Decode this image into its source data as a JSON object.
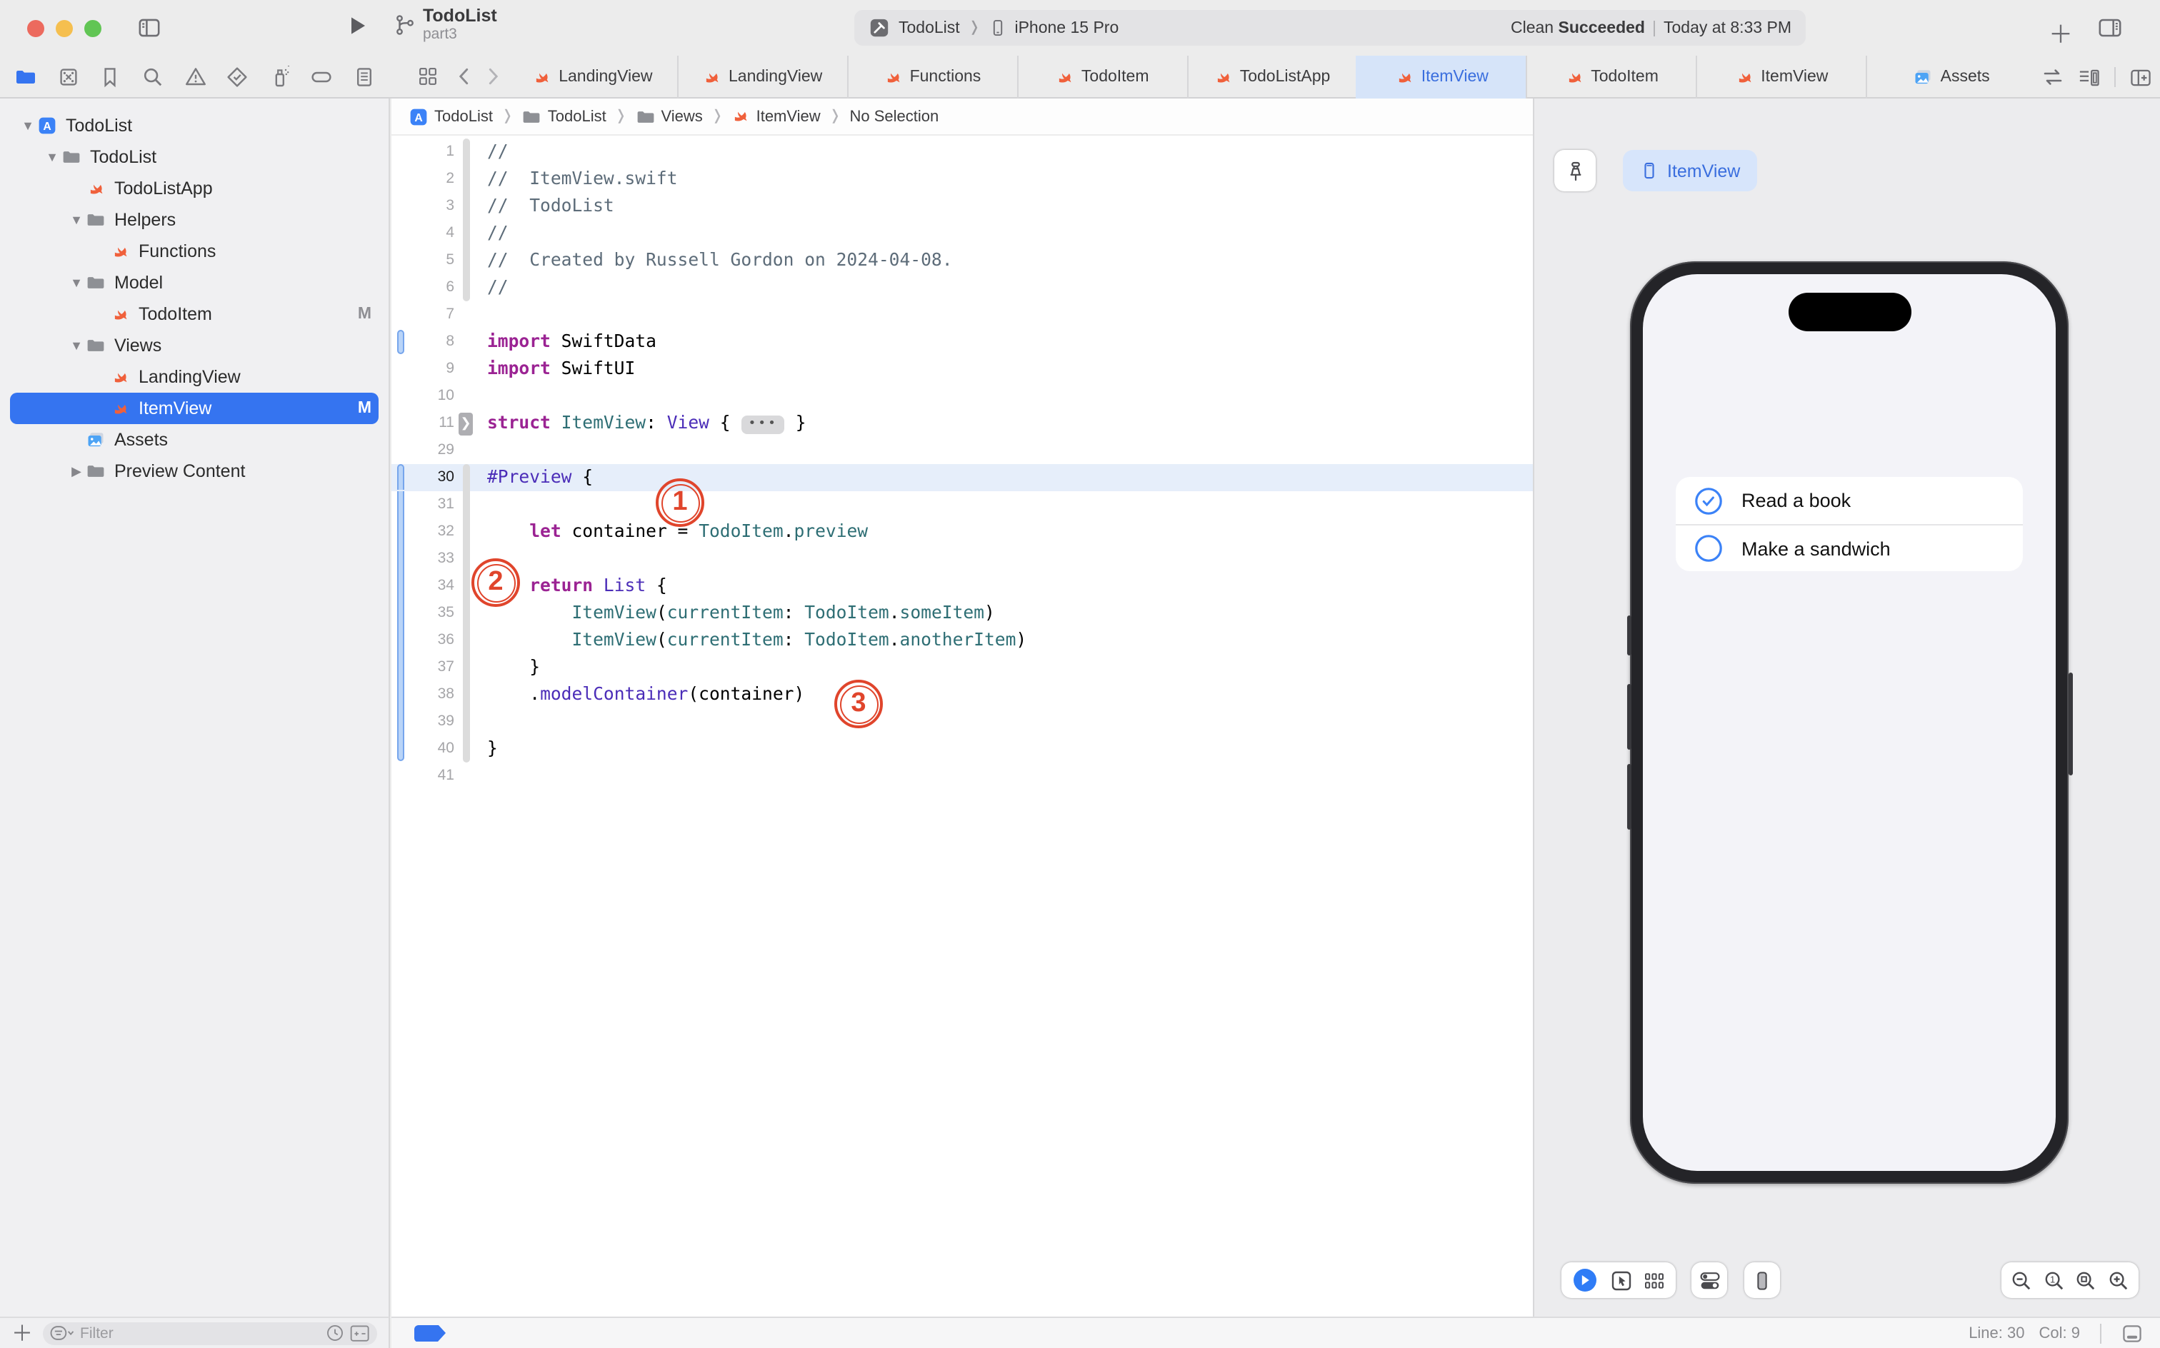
{
  "titlebar": {
    "project": "TodoList",
    "branch": "part3",
    "scheme_target": "TodoList",
    "scheme_device": "iPhone 15 Pro",
    "status_action": "Clean",
    "status_result": "Succeeded",
    "status_time": "Today at 8:33 PM"
  },
  "navigators": [
    "project",
    "source-control",
    "bookmarks",
    "find",
    "issues",
    "tests",
    "debug",
    "breakpoints",
    "reports"
  ],
  "tabs": [
    {
      "label": "LandingView",
      "icon": "swift",
      "active": false
    },
    {
      "label": "LandingView",
      "icon": "swift",
      "active": false
    },
    {
      "label": "Functions",
      "icon": "swift",
      "active": false
    },
    {
      "label": "TodoItem",
      "icon": "swift",
      "active": false
    },
    {
      "label": "TodoListApp",
      "icon": "swift",
      "active": false
    },
    {
      "label": "ItemView",
      "icon": "swift",
      "active": true
    },
    {
      "label": "TodoItem",
      "icon": "swift",
      "active": false
    },
    {
      "label": "ItemView",
      "icon": "swift",
      "active": false
    },
    {
      "label": "Assets",
      "icon": "assets",
      "active": false
    }
  ],
  "breadcrumb": [
    {
      "icon": "app",
      "label": "TodoList"
    },
    {
      "icon": "folder",
      "label": "TodoList"
    },
    {
      "icon": "folder",
      "label": "Views"
    },
    {
      "icon": "swift",
      "label": "ItemView"
    },
    {
      "icon": "none",
      "label": "No Selection"
    }
  ],
  "sidebar": {
    "items": [
      {
        "label": "TodoList",
        "icon": "app",
        "depth": 0,
        "disc": "open",
        "sel": false,
        "badge": ""
      },
      {
        "label": "TodoList",
        "icon": "folder",
        "depth": 1,
        "disc": "open",
        "sel": false,
        "badge": ""
      },
      {
        "label": "TodoListApp",
        "icon": "swift",
        "depth": 2,
        "disc": "none",
        "sel": false,
        "badge": ""
      },
      {
        "label": "Helpers",
        "icon": "folder",
        "depth": 2,
        "disc": "open",
        "sel": false,
        "badge": ""
      },
      {
        "label": "Functions",
        "icon": "swift",
        "depth": 3,
        "disc": "none",
        "sel": false,
        "badge": ""
      },
      {
        "label": "Model",
        "icon": "folder",
        "depth": 2,
        "disc": "open",
        "sel": false,
        "badge": ""
      },
      {
        "label": "TodoItem",
        "icon": "swift",
        "depth": 3,
        "disc": "none",
        "sel": false,
        "badge": "M"
      },
      {
        "label": "Views",
        "icon": "folder",
        "depth": 2,
        "disc": "open",
        "sel": false,
        "badge": ""
      },
      {
        "label": "LandingView",
        "icon": "swift",
        "depth": 3,
        "disc": "none",
        "sel": false,
        "badge": ""
      },
      {
        "label": "ItemView",
        "icon": "swift",
        "depth": 3,
        "disc": "none",
        "sel": true,
        "badge": "M"
      },
      {
        "label": "Assets",
        "icon": "assets",
        "depth": 2,
        "disc": "none",
        "sel": false,
        "badge": ""
      },
      {
        "label": "Preview Content",
        "icon": "folder",
        "depth": 2,
        "disc": "closed",
        "sel": false,
        "badge": ""
      }
    ],
    "filter_placeholder": "Filter"
  },
  "editor": {
    "lines": [
      {
        "n": "1",
        "strip": "top",
        "tokens": [
          [
            "c",
            "//"
          ]
        ]
      },
      {
        "n": "2",
        "strip": "mid",
        "tokens": [
          [
            "c",
            "//  ItemView.swift"
          ]
        ]
      },
      {
        "n": "3",
        "strip": "mid",
        "tokens": [
          [
            "c",
            "//  TodoList"
          ]
        ]
      },
      {
        "n": "4",
        "strip": "mid",
        "tokens": [
          [
            "c",
            "//"
          ]
        ]
      },
      {
        "n": "5",
        "strip": "mid",
        "tokens": [
          [
            "c",
            "//  Created by Russell Gordon on 2024-04-08."
          ]
        ]
      },
      {
        "n": "6",
        "strip": "bot",
        "tokens": [
          [
            "c",
            "//"
          ]
        ]
      },
      {
        "n": "7",
        "tokens": []
      },
      {
        "n": "8",
        "chg": "solo",
        "tokens": [
          [
            "k",
            "import"
          ],
          [
            "p",
            " SwiftData"
          ]
        ]
      },
      {
        "n": "9",
        "tokens": [
          [
            "k",
            "import"
          ],
          [
            "p",
            " SwiftUI"
          ]
        ]
      },
      {
        "n": "10",
        "tokens": []
      },
      {
        "n": "11",
        "fold": true,
        "tokens": [
          [
            "k",
            "struct"
          ],
          [
            "p",
            " "
          ],
          [
            "m",
            "ItemView"
          ],
          [
            "p",
            ": "
          ],
          [
            "t",
            "View"
          ],
          [
            "p",
            " { "
          ],
          [
            "chip",
            "•••"
          ],
          [
            "p",
            " }"
          ]
        ]
      },
      {
        "n": "29",
        "tokens": []
      },
      {
        "n": "30",
        "cur": true,
        "chg": "top",
        "strip": "top",
        "tokens": [
          [
            "t",
            "#Preview"
          ],
          [
            "p",
            " {"
          ]
        ]
      },
      {
        "n": "31",
        "chg": "mid",
        "strip": "mid",
        "tokens": []
      },
      {
        "n": "32",
        "chg": "mid",
        "strip": "mid",
        "tokens": [
          [
            "p",
            "    "
          ],
          [
            "k",
            "let"
          ],
          [
            "p",
            " container = "
          ],
          [
            "m",
            "TodoItem"
          ],
          [
            "p",
            "."
          ],
          [
            "m",
            "preview"
          ]
        ]
      },
      {
        "n": "33",
        "chg": "mid",
        "strip": "mid",
        "tokens": []
      },
      {
        "n": "34",
        "chg": "mid",
        "strip": "mid",
        "tokens": [
          [
            "p",
            "    "
          ],
          [
            "k",
            "return"
          ],
          [
            "p",
            " "
          ],
          [
            "t",
            "List"
          ],
          [
            "p",
            " {"
          ]
        ]
      },
      {
        "n": "35",
        "chg": "mid",
        "strip": "mid",
        "tokens": [
          [
            "p",
            "        "
          ],
          [
            "m",
            "ItemView"
          ],
          [
            "p",
            "("
          ],
          [
            "m",
            "currentItem"
          ],
          [
            "p",
            ": "
          ],
          [
            "m",
            "TodoItem"
          ],
          [
            "p",
            "."
          ],
          [
            "m",
            "someItem"
          ],
          [
            "p",
            ")"
          ]
        ]
      },
      {
        "n": "36",
        "chg": "mid",
        "strip": "mid",
        "tokens": [
          [
            "p",
            "        "
          ],
          [
            "m",
            "ItemView"
          ],
          [
            "p",
            "("
          ],
          [
            "m",
            "currentItem"
          ],
          [
            "p",
            ": "
          ],
          [
            "m",
            "TodoItem"
          ],
          [
            "p",
            "."
          ],
          [
            "m",
            "anotherItem"
          ],
          [
            "p",
            ")"
          ]
        ]
      },
      {
        "n": "37",
        "chg": "mid",
        "strip": "mid",
        "tokens": [
          [
            "p",
            "    }"
          ]
        ]
      },
      {
        "n": "38",
        "chg": "mid",
        "strip": "mid",
        "tokens": [
          [
            "p",
            "    ."
          ],
          [
            "t",
            "modelContainer"
          ],
          [
            "p",
            "(container)"
          ]
        ]
      },
      {
        "n": "39",
        "chg": "mid",
        "strip": "mid",
        "tokens": []
      },
      {
        "n": "40",
        "chg": "bot",
        "strip": "bot",
        "tokens": [
          [
            "p",
            "}"
          ]
        ]
      },
      {
        "n": "41",
        "tokens": []
      }
    ],
    "annotations": [
      {
        "label": "1"
      },
      {
        "label": "2"
      },
      {
        "label": "3"
      }
    ]
  },
  "canvas": {
    "chip_label": "ItemView",
    "todos": [
      {
        "text": "Read a book",
        "done": true
      },
      {
        "text": "Make a sandwich",
        "done": false
      }
    ]
  },
  "statusbar": {
    "line": "Line: 30",
    "col": "Col: 9"
  },
  "colors": {
    "accent_blue": "#3574f0",
    "tab_active_bg": "#d6e4f9",
    "swift_orange": "#f0603b",
    "annotation_red": "#e0452c",
    "keyword": "#9b2393",
    "type_purple": "#4b2db8",
    "member_teal": "#2e6e74",
    "comment_gray": "#5d6c79"
  }
}
